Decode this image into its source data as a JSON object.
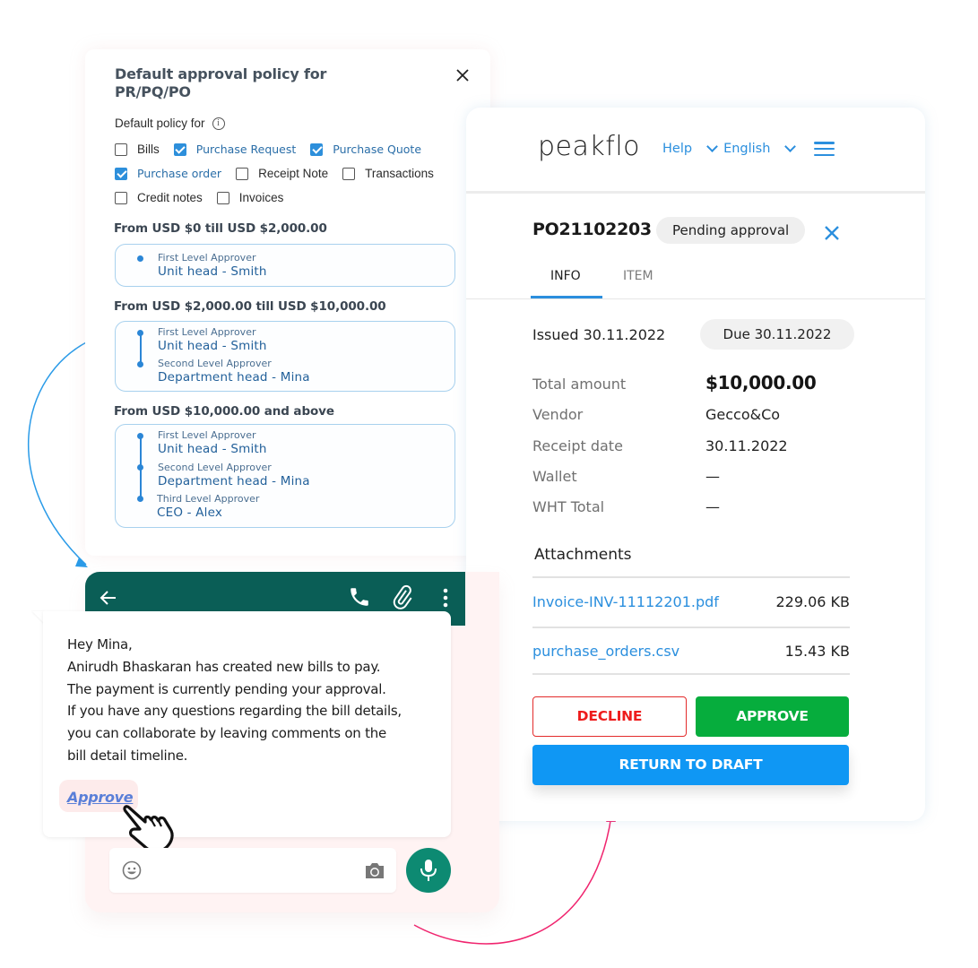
{
  "policy": {
    "title": "Default approval policy for PR/PQ/PO",
    "subtitle": "Default policy for",
    "checkboxes": [
      {
        "label": "Bills",
        "checked": false
      },
      {
        "label": "Purchase Request",
        "checked": true
      },
      {
        "label": "Purchase Quote",
        "checked": true
      },
      {
        "label": "Purchase order",
        "checked": true
      },
      {
        "label": "Receipt Note",
        "checked": false
      },
      {
        "label": "Transactions",
        "checked": false
      },
      {
        "label": "Credit notes",
        "checked": false
      },
      {
        "label": "Invoices",
        "checked": false
      }
    ],
    "tiers": [
      {
        "heading": "From USD $0 till USD $2,000.00",
        "approvers": [
          {
            "level": "First Level Approver",
            "name": "Unit head - Smith"
          }
        ]
      },
      {
        "heading": "From USD $2,000.00 till USD $10,000.00",
        "approvers": [
          {
            "level": "First Level Approver",
            "name": "Unit head - Smith"
          },
          {
            "level": "Second Level Approver",
            "name": "Department head - Mina"
          }
        ]
      },
      {
        "heading": "From USD $10,000.00 and above",
        "approvers": [
          {
            "level": "First Level Approver",
            "name": "Unit head - Smith"
          },
          {
            "level": "Second Level Approver",
            "name": "Department head - Mina"
          },
          {
            "level": "Third Level Approver",
            "name": "CEO - Alex"
          }
        ]
      }
    ]
  },
  "peakflo": {
    "logo": "peakflo",
    "nav": {
      "help": "Help",
      "language": "English"
    },
    "document_id": "PO21102203",
    "status": "Pending approval",
    "tabs": [
      {
        "label": "INFO",
        "active": true
      },
      {
        "label": "ITEM",
        "active": false
      }
    ],
    "issued": "Issued 30.11.2022",
    "due": "Due 30.11.2022",
    "fields": [
      {
        "label": "Total amount",
        "value": "$10,000.00"
      },
      {
        "label": "Vendor",
        "value": "Gecco&Co"
      },
      {
        "label": "Receipt date",
        "value": "30.11.2022"
      },
      {
        "label": "Wallet",
        "value": "—"
      },
      {
        "label": "WHT Total",
        "value": "—"
      }
    ],
    "attachments_title": "Attachments",
    "attachments": [
      {
        "name": "Invoice-INV-11112201.pdf",
        "size": "229.06 KB"
      },
      {
        "name": "purchase_orders.csv",
        "size": "15.43 KB"
      }
    ],
    "buttons": {
      "decline": "DECLINE",
      "approve": "APPROVE",
      "return_to_draft": "RETURN TO DRAFT"
    }
  },
  "chat": {
    "message_lines": [
      "Hey Mina,",
      "Anirudh Bhaskaran has created new bills to pay.",
      "The payment is currently pending your approval.",
      "If you have any questions regarding the bill details,",
      "you can collaborate by leaving comments on the",
      "bill detail timeline."
    ],
    "approve_link": "Approve"
  },
  "colors": {
    "brand_blue": "#2b8fde",
    "whatsapp_green": "#0a5e56",
    "approve_green": "#06ad3d",
    "decline_red": "#ee1c1c",
    "draft_blue": "#0f97f4",
    "arrow_blue": "#2a9be8",
    "arrow_pink": "#f0246e"
  }
}
